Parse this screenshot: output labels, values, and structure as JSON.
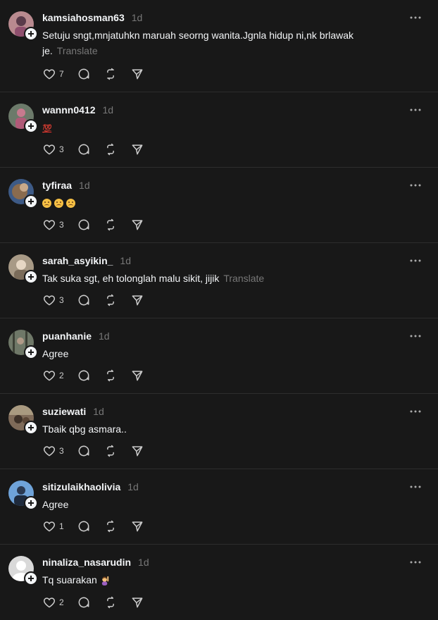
{
  "translate_label": "Translate",
  "posts": [
    {
      "username": "kamsiahosman63",
      "time": "1d",
      "text": "Setuju sngt,mnjatuhkn maruah seorng wanita.Jgnla hidup ni,nk brlawak je.",
      "likes": "7",
      "avatar_color": "#b98a8f"
    },
    {
      "username": "wannn0412",
      "time": "1d",
      "text": "💯",
      "likes": "3",
      "avatar_color": "#6c7a6a"
    },
    {
      "username": "tyfiraa",
      "time": "1d",
      "text": "😦😦😦",
      "likes": "3",
      "avatar_color": "#8a6b4e"
    },
    {
      "username": "sarah_asyikin_",
      "time": "1d",
      "text": "Tak suka sgt, eh tolonglah malu sikit, jijik",
      "likes": "3",
      "avatar_color": "#a89a86"
    },
    {
      "username": "puanhanie",
      "time": "1d",
      "text": "Agree",
      "likes": "2",
      "avatar_color": "#6f7868"
    },
    {
      "username": "suziewati",
      "time": "1d",
      "text": "Tbaik qbg asmara..",
      "likes": "3",
      "avatar_color": "#7f6b59"
    },
    {
      "username": "sitizulaikhaolivia",
      "time": "1d",
      "text": "Agree",
      "likes": "1",
      "avatar_color": "#4b7fb8"
    },
    {
      "username": "ninaliza_nasarudin",
      "time": "1d",
      "text": "Tq suarakan",
      "likes": "2",
      "avatar_color": "#d9d9d9"
    }
  ]
}
